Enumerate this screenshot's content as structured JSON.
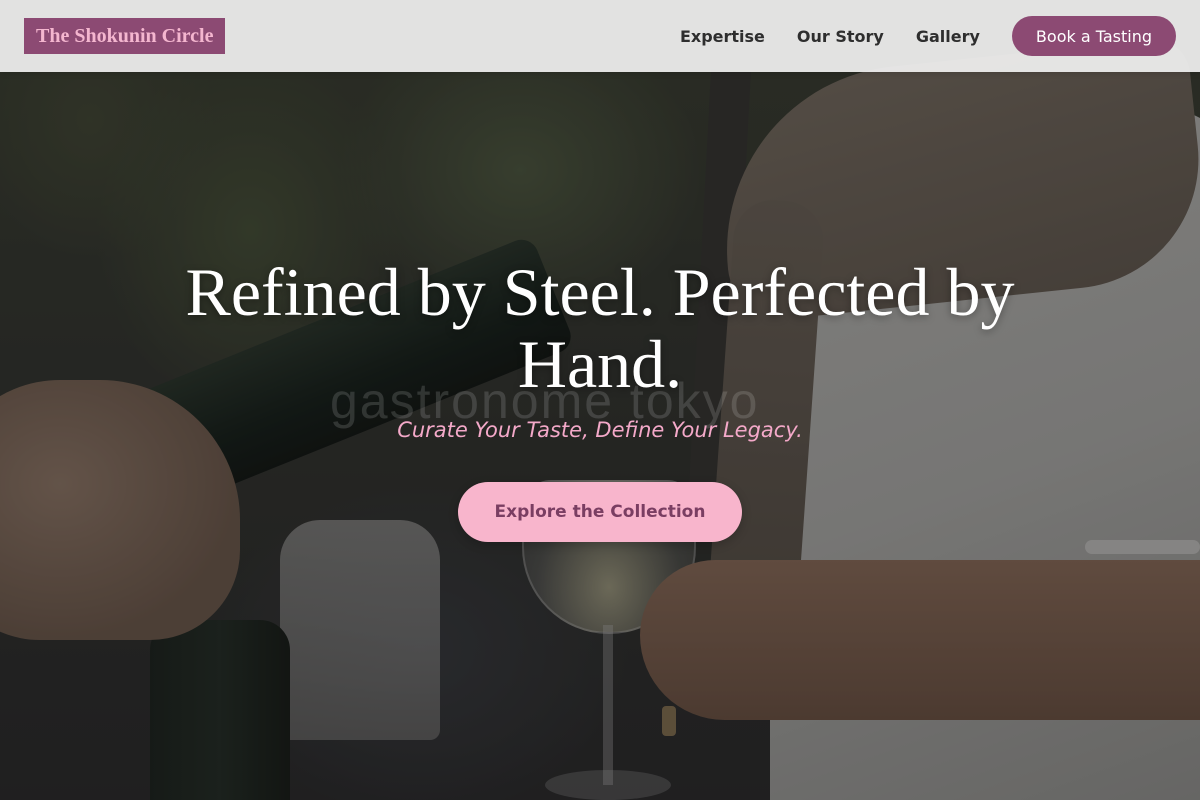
{
  "header": {
    "logo_text": "The Shokunin Circle",
    "nav": [
      {
        "label": "Expertise"
      },
      {
        "label": "Our Story"
      },
      {
        "label": "Gallery"
      }
    ],
    "cta_label": "Book a Tasting"
  },
  "hero": {
    "headline": "Refined by Steel. Perfected by Hand.",
    "tagline": "Curate Your Taste, Define Your Legacy.",
    "button_label": "Explore the Collection",
    "watermark": "gastronome tokyo"
  },
  "colors": {
    "brand": "#8c4a73",
    "logo_text": "#f4b6cf",
    "accent_pink": "#f8b5cc",
    "tagline": "#f4a9c9",
    "button_text": "#7a3e62"
  }
}
